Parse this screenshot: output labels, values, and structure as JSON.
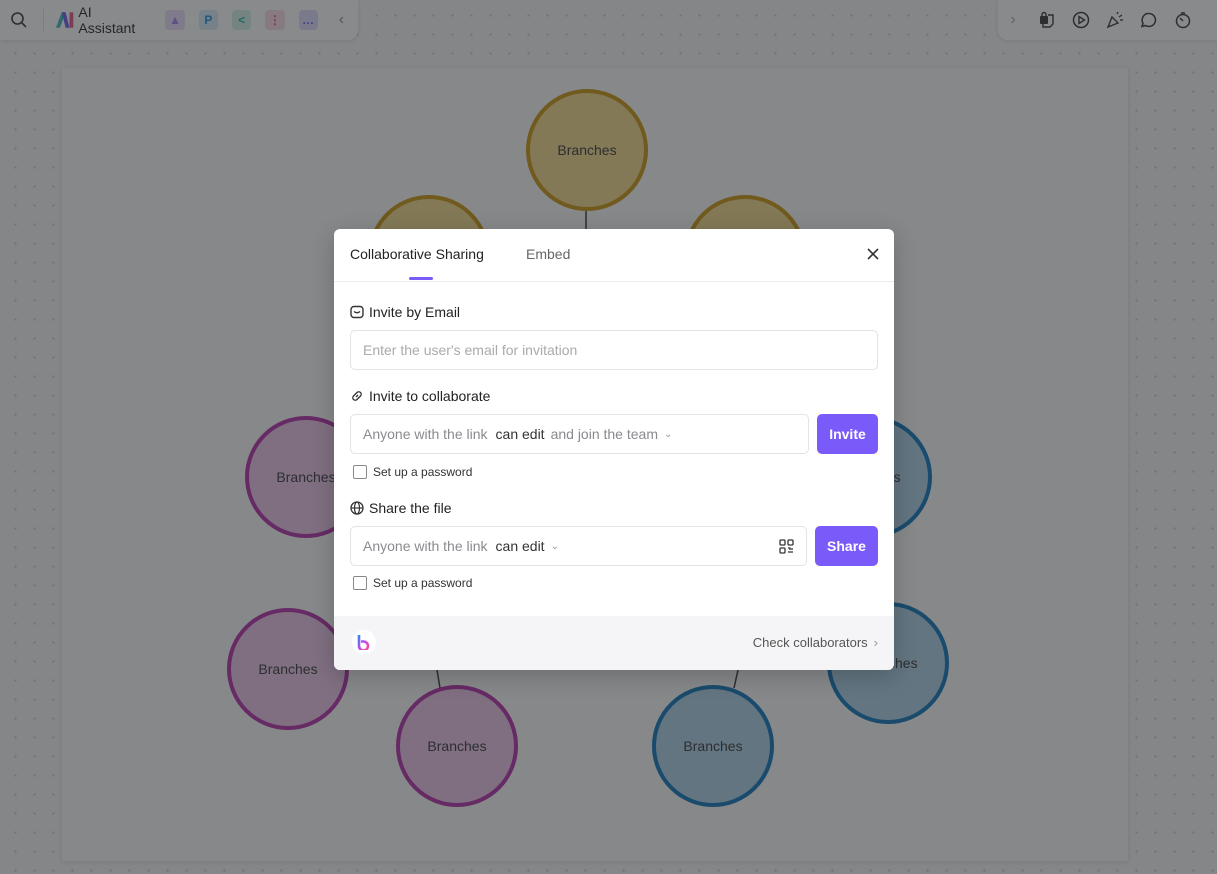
{
  "toolbar_left": {
    "ai_assistant_label": "AI Assistant",
    "apps": [
      {
        "name": "image-app",
        "glyph": "▲",
        "color": "#a27ff0"
      },
      {
        "name": "p-app",
        "glyph": "P",
        "color": "#1d8fd6"
      },
      {
        "name": "mindmap-app",
        "glyph": "<",
        "color": "#16b39b"
      },
      {
        "name": "flow-app",
        "glyph": "⋮",
        "color": "#e84c7d"
      },
      {
        "name": "chat-app",
        "glyph": "…",
        "color": "#5b5ef0"
      }
    ]
  },
  "canvas": {
    "nodes": [
      {
        "label": "Branches",
        "color": "gold"
      },
      {
        "label": "",
        "color": "gold"
      },
      {
        "label": "",
        "color": "gold"
      },
      {
        "label": "Branches",
        "color": "pink"
      },
      {
        "label": "Branches",
        "color": "pink"
      },
      {
        "label": "Branches",
        "color": "pink"
      },
      {
        "label": "Branches",
        "color": "blue"
      },
      {
        "label": "Branches",
        "color": "blue"
      },
      {
        "label": "Branches",
        "color": "blue"
      }
    ]
  },
  "modal": {
    "tabs": [
      {
        "label": "Collaborative Sharing",
        "active": true
      },
      {
        "label": "Embed",
        "active": false
      }
    ],
    "invite_email": {
      "title": "Invite by Email",
      "placeholder": "Enter the user's email for invitation"
    },
    "invite_collab": {
      "title": "Invite to collaborate",
      "prefix": "Anyone with the link",
      "permission": "can edit",
      "suffix": "and join the team",
      "button": "Invite",
      "password_label": "Set up a password"
    },
    "share_file": {
      "title": "Share the file",
      "prefix": "Anyone with the link",
      "permission": "can edit",
      "button": "Share",
      "password_label": "Set up a password"
    },
    "footer": {
      "check_collaborators": "Check collaborators"
    },
    "accent_color": "#7a5af8"
  }
}
